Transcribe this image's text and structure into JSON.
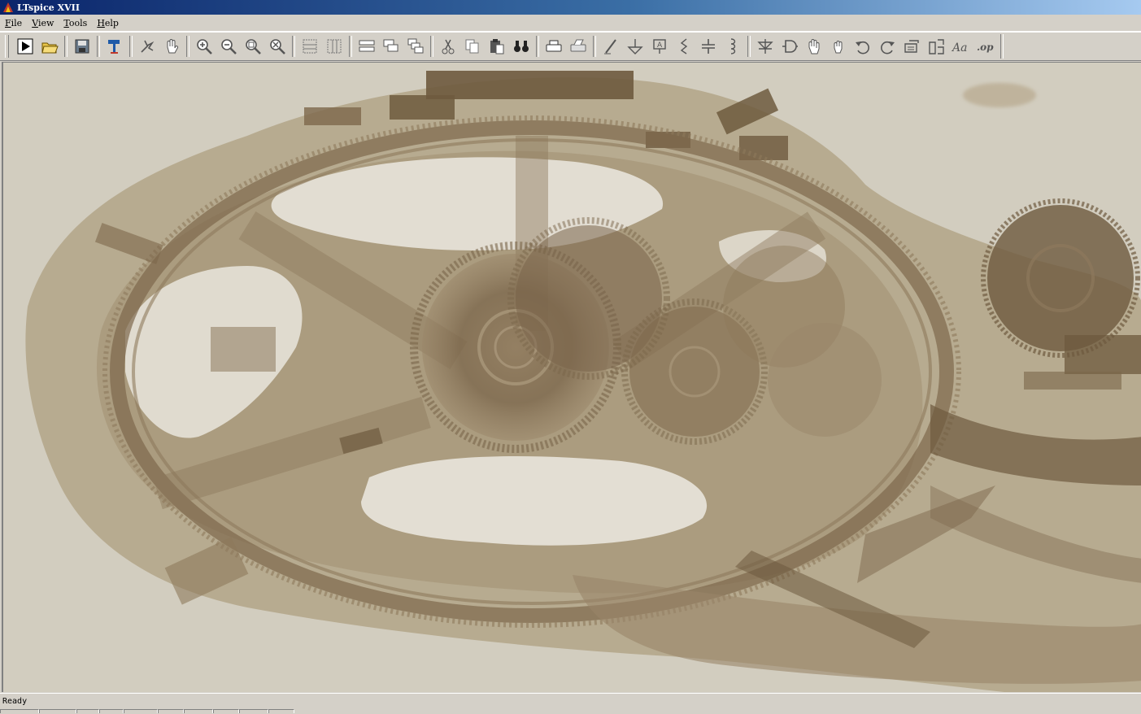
{
  "window": {
    "title": "LTspice XVII",
    "icon": "ltspice-app-icon"
  },
  "menu": [
    {
      "label": "File",
      "mnemonic": "F",
      "rest": "ile"
    },
    {
      "label": "View",
      "mnemonic": "V",
      "rest": "iew"
    },
    {
      "label": "Tools",
      "mnemonic": "T",
      "rest": "ools"
    },
    {
      "label": "Help",
      "mnemonic": "H",
      "rest": "elp"
    }
  ],
  "toolbar_icons": [
    "run-icon",
    "open-folder-icon",
    "save-icon",
    "hammer-icon",
    "halt-icon",
    "pan-hand-icon",
    "zoom-in-icon",
    "zoom-out-icon",
    "zoom-fit-icon",
    "zoom-cancel-icon",
    "tile-horizontal-icon",
    "tile-vertical-icon",
    "cascade-icon",
    "close-window-icon",
    "arrange-icon",
    "cut-icon",
    "copy-icon",
    "paste-icon",
    "find-icon",
    "print-icon",
    "print-setup-icon",
    "wire-icon",
    "ground-icon",
    "label-net-icon",
    "resistor-icon",
    "capacitor-icon",
    "inductor-icon",
    "diode-icon",
    "component-icon",
    "move-hand-icon",
    "drag-hand-icon",
    "undo-icon",
    "redo-icon",
    "rotate-icon",
    "mirror-icon",
    "text-icon",
    "spice-directive-icon"
  ],
  "status": {
    "text": "Ready"
  },
  "colors": {
    "title_start": "#0a246a",
    "title_end": "#a6caf0",
    "chrome": "#d4d0c8",
    "workspace_bg": "#d2cdbf",
    "sepia_dark": "#6e5a3e",
    "sepia_mid": "#9a8669",
    "sepia_light": "#b8a98e"
  }
}
